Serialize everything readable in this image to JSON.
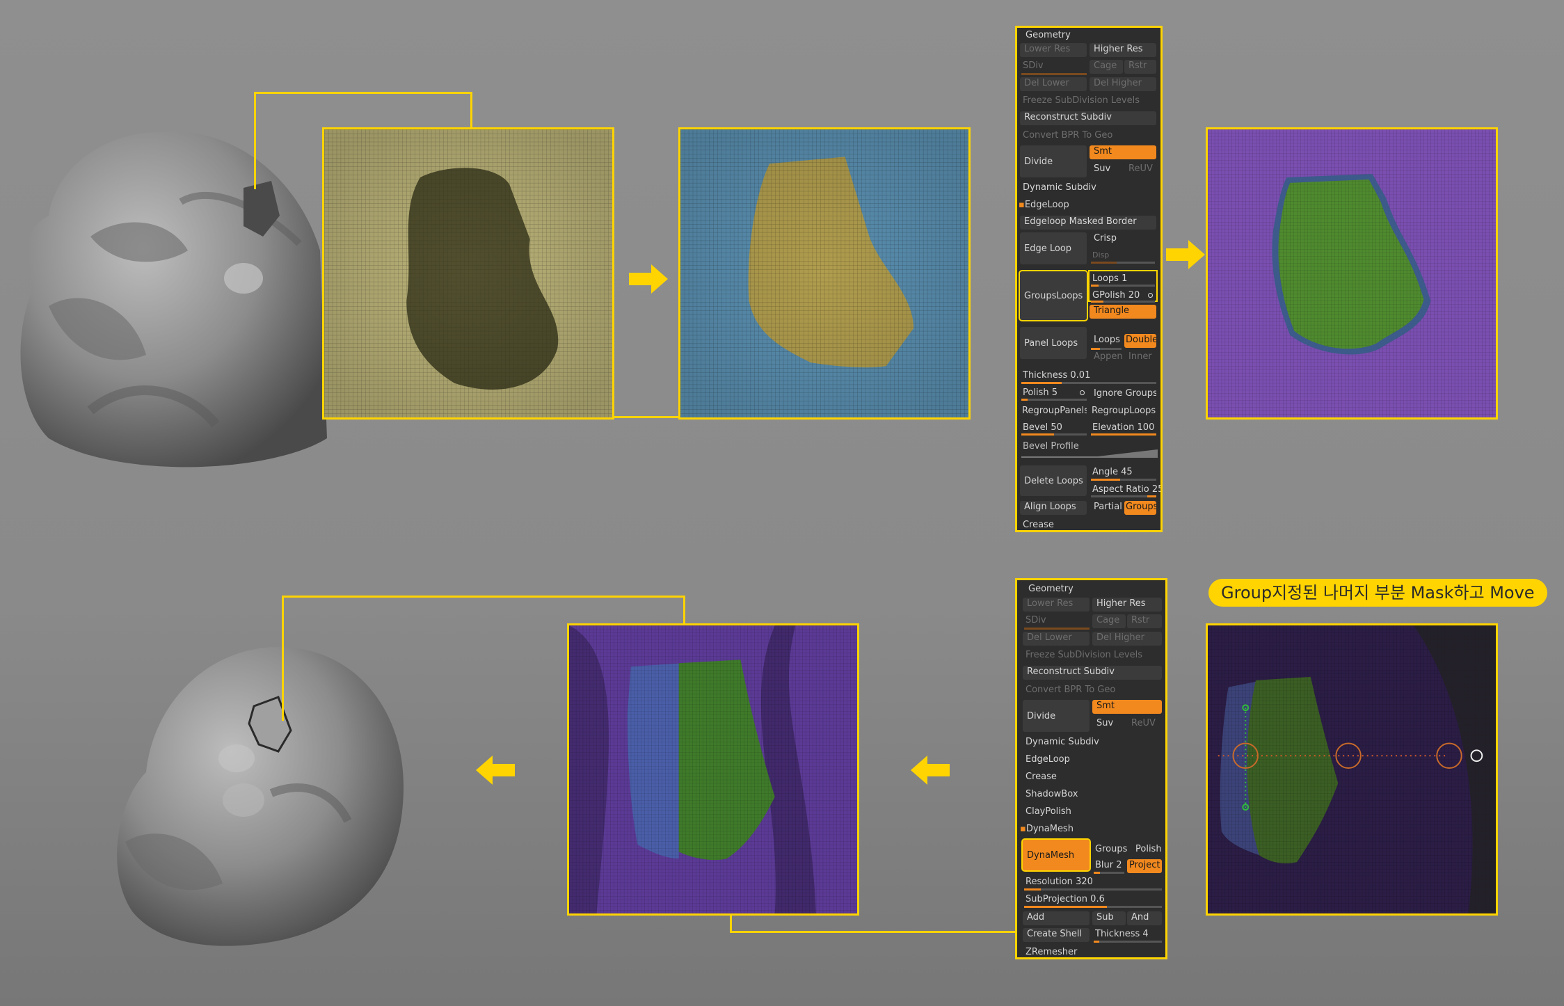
{
  "top_panel": {
    "title": "Geometry",
    "lower_res": "Lower Res",
    "higher_res": "Higher Res",
    "sdiv": "SDiv",
    "cage": "Cage",
    "rstr": "Rstr",
    "del_lower": "Del Lower",
    "del_higher": "Del Higher",
    "freeze": "Freeze SubDivision Levels",
    "reconstruct": "Reconstruct Subdiv",
    "convert_bpr": "Convert BPR To Geo",
    "divide": "Divide",
    "smt": "Smt",
    "suv": "Suv",
    "reuv": "ReUV",
    "dynamic_subdiv": "Dynamic Subdiv",
    "edgeloop": "EdgeLoop",
    "edgeloop_masked": "Edgeloop Masked Border",
    "edge_loop": "Edge Loop",
    "crisp": "Crisp",
    "disp": "Disp",
    "groups_loops": "GroupsLoops",
    "loops": "Loops",
    "loops_value": "1",
    "gpolish": "GPolish",
    "gpolish_value": "20",
    "triangle": "Triangle",
    "panel_loops": "Panel Loops",
    "loops2": "Loops",
    "double": "Double",
    "append": "Appenc",
    "inner": "Inner",
    "thickness": "Thickness",
    "thickness_value": "0.01",
    "polish": "Polish",
    "polish_value": "5",
    "ignore_groups": "Ignore Groups",
    "regroup_panels": "RegroupPanels",
    "regroup_loops": "RegroupLoops",
    "bevel": "Bevel",
    "bevel_value": "50",
    "elevation": "Elevation",
    "elevation_value": "100",
    "bevel_profile": "Bevel Profile",
    "delete_loops": "Delete Loops",
    "angle": "Angle",
    "angle_value": "45",
    "aspect_ratio": "Aspect Ratio",
    "aspect_value": "25",
    "align_loops": "Align Loops",
    "partial": "Partial",
    "groups": "Groups",
    "crease": "Crease"
  },
  "bottom_panel": {
    "title": "Geometry",
    "lower_res": "Lower Res",
    "higher_res": "Higher Res",
    "sdiv": "SDiv",
    "cage": "Cage",
    "rstr": "Rstr",
    "del_lower": "Del Lower",
    "del_higher": "Del Higher",
    "freeze": "Freeze SubDivision Levels",
    "reconstruct": "Reconstruct Subdiv",
    "convert_bpr": "Convert BPR To Geo",
    "divide": "Divide",
    "smt": "Smt",
    "suv": "Suv",
    "reuv": "ReUV",
    "dynamic_subdiv": "Dynamic Subdiv",
    "edgeloop": "EdgeLoop",
    "crease": "Crease",
    "shadowbox": "ShadowBox",
    "claypolish": "ClayPolish",
    "dynamesh_header": "DynaMesh",
    "dynamesh_button": "DynaMesh",
    "groups": "Groups",
    "polish": "Polish",
    "blur": "Blur",
    "blur_value": "2",
    "project": "Project",
    "resolution": "Resolution",
    "resolution_value": "320",
    "subprojection": "SubProjection",
    "subprojection_value": "0.6",
    "add": "Add",
    "sub": "Sub",
    "and": "And",
    "create_shell": "Create Shell",
    "thickness": "Thickness",
    "thickness_value": "4",
    "zremesher": "ZRemesher"
  },
  "caption": "Group지정된 나머지 부분 Mask하고 Move",
  "colors": {
    "highlight": "#ffd400",
    "zbrush_orange": "#f2891e",
    "panel_bg": "#2d2d2d",
    "mask_yellow": "#c9c07a",
    "polygroup_blue": "#5a8fb0",
    "polygroup_purple": "#7a4fb0",
    "polygroup_green": "#4f8a2f"
  },
  "icons": {
    "arrow": "yellow-arrow-icon",
    "gizmo": "transpose-move-gizmo-icon"
  }
}
